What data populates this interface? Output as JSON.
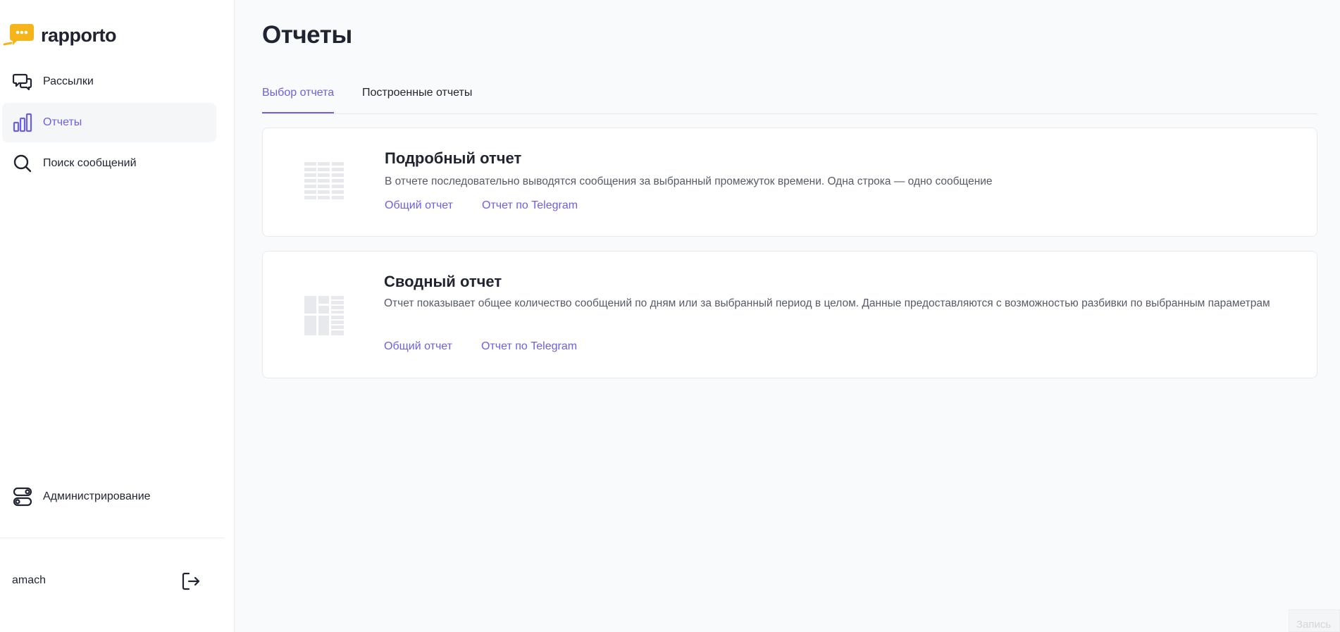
{
  "app": {
    "name": "rapporto",
    "brand_color": "#f4b41a",
    "accent_color": "#6a61e8"
  },
  "sidebar": {
    "items": [
      {
        "label": "Рассылки",
        "icon": "chat-bubbles-icon",
        "active": false
      },
      {
        "label": "Отчеты",
        "icon": "bar-chart-icon",
        "active": true
      },
      {
        "label": "Поиск сообщений",
        "icon": "search-icon",
        "active": false
      }
    ],
    "admin": {
      "label": "Администрирование",
      "icon": "toggles-icon"
    },
    "user": {
      "name": "amach",
      "logout_icon": "logout-icon"
    }
  },
  "main": {
    "title": "Отчеты",
    "tabs": [
      {
        "label": "Выбор отчета",
        "active": true
      },
      {
        "label": "Построенные отчеты",
        "active": false
      }
    ],
    "cards": [
      {
        "title": "Подробный отчет",
        "description": "В отчете последовательно выводятся сообщения за выбранный промежуток времени. Одна строка — одно сообщение",
        "icon": "detailed-table-icon",
        "links": [
          "Общий отчет",
          "Отчет по Telegram"
        ]
      },
      {
        "title": "Сводный отчет",
        "description": "Отчет показывает общее количество сообщений по дням или за выбранный период в целом. Данные предоставляются с возможностью разбивки по выбранным параметрам",
        "icon": "summary-table-icon",
        "links": [
          "Общий отчет",
          "Отчет по Telegram"
        ]
      }
    ]
  },
  "corner": {
    "label": "Запись"
  }
}
